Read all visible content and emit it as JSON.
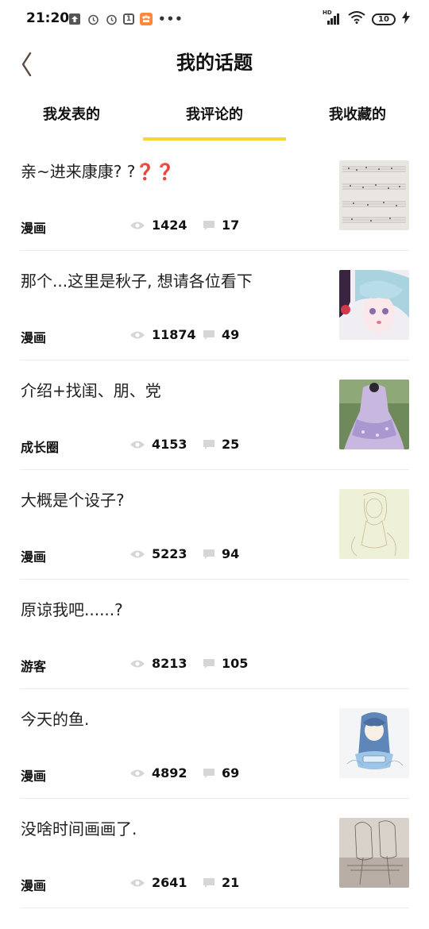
{
  "status_bar": {
    "time": "21:20",
    "battery": "10",
    "network_label": "HD"
  },
  "header": {
    "title": "我的话题"
  },
  "tabs": [
    {
      "label": "我发表的",
      "active": false
    },
    {
      "label": "我评论的",
      "active": true
    },
    {
      "label": "我收藏的",
      "active": false
    }
  ],
  "items": [
    {
      "title": "亲~进来康康? ?❓❓",
      "category": "漫画",
      "views": "1424",
      "comments": "17",
      "thumb": "sheet-music-thumbnail"
    },
    {
      "title": "那个...这里是秋子, 想请各位看下",
      "category": "漫画",
      "views": "11874",
      "comments": "49",
      "thumb": "anime-girl-thumbnail"
    },
    {
      "title": "介绍+找闺、朋、党",
      "category": "成长圈",
      "views": "4153",
      "comments": "25",
      "thumb": "lolita-dress-thumbnail"
    },
    {
      "title": "大概是个设子?",
      "category": "漫画",
      "views": "5223",
      "comments": "94",
      "thumb": "sketch-thumbnail"
    },
    {
      "title": "原谅我吧......?",
      "category": "游客",
      "views": "8213",
      "comments": "105",
      "thumb": ""
    },
    {
      "title": "今天的鱼.",
      "category": "漫画",
      "views": "4892",
      "comments": "69",
      "thumb": "blue-girl-drawing-thumbnail"
    },
    {
      "title": "没啥时间画画了.",
      "category": "漫画",
      "views": "2641",
      "comments": "21",
      "thumb": "pencil-sketch-thumbnail"
    }
  ],
  "colors": {
    "tab_underline": "#ffd43b",
    "divider": "#ececec"
  }
}
